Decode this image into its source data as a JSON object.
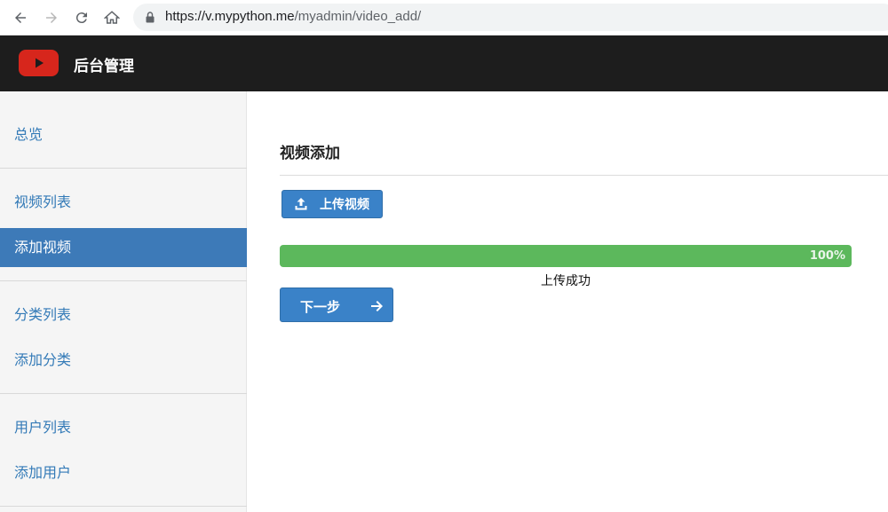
{
  "browser": {
    "url_host": "https://v.mypython.me",
    "url_path": "/myadmin/video_add/",
    "icons": [
      "back-arrow-icon",
      "forward-arrow-icon",
      "reload-icon",
      "home-icon",
      "lock-icon"
    ]
  },
  "header": {
    "title": "后台管理",
    "logo_icon": "youtube-play-icon",
    "brand_color": "#d7261c"
  },
  "sidebar": {
    "items": [
      {
        "label": "总览"
      },
      {
        "label": "视频列表"
      },
      {
        "label": "添加视频",
        "active": true
      },
      {
        "label": "分类列表"
      },
      {
        "label": "添加分类"
      },
      {
        "label": "用户列表"
      },
      {
        "label": "添加用户"
      }
    ]
  },
  "main": {
    "title": "视频添加",
    "upload_button": {
      "label": "上传视频",
      "icon": "upload-icon"
    },
    "progress": {
      "value": 1.0,
      "text": "100%",
      "color": "#5cb85c"
    },
    "status": "上传成功",
    "next_button": {
      "label": "下一步",
      "icon": "arrow-right-icon"
    }
  },
  "colors": {
    "accent": "#3a82c8",
    "active_nav": "#3d7ab8",
    "header_bg": "#1d1d1d"
  }
}
